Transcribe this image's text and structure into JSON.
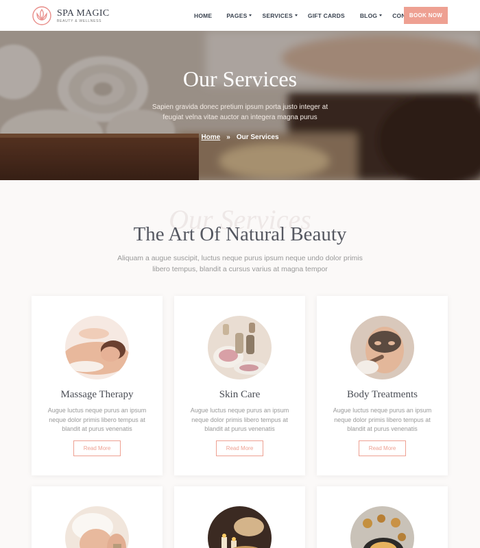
{
  "brand": {
    "name": "SPA MAGIC",
    "tagline": "BEAUTY & WELLNESS",
    "accent": "#eea092"
  },
  "nav": {
    "items": [
      {
        "label": "HOME",
        "dropdown": false
      },
      {
        "label": "PAGES",
        "dropdown": true
      },
      {
        "label": "SERVICES",
        "dropdown": true
      },
      {
        "label": "GIFT CARDS",
        "dropdown": false
      },
      {
        "label": "BLOG",
        "dropdown": true
      },
      {
        "label": "CONTACTS",
        "dropdown": false
      }
    ],
    "cta": "BOOK NOW"
  },
  "hero": {
    "title": "Our Services",
    "subtitle": "Sapien gravida donec pretium ipsum porta justo integer at feugiat velna vitae auctor an integera magna purus",
    "breadcrumb": {
      "home": "Home",
      "separator": "»",
      "current": "Our Services"
    }
  },
  "section": {
    "watermark": "Our Services",
    "title": "The Art Of Natural Beauty",
    "subtitle": "Aliquam a augue suscipit, luctus neque purus ipsum neque undo dolor primis libero tempus, blandit a cursus varius at magna tempor"
  },
  "cards": [
    {
      "title": "Massage Therapy",
      "text": "Augue luctus neque purus an ipsum neque dolor primis libero tempus at blandit at purus venenatis",
      "button": "Read More",
      "image": "massage-photo"
    },
    {
      "title": "Skin Care",
      "text": "Augue luctus neque purus an ipsum neque dolor primis libero tempus at blandit at purus venenatis",
      "button": "Read More",
      "image": "skin-care-photo"
    },
    {
      "title": "Body Treatments",
      "text": "Augue luctus neque purus an ipsum neque dolor primis libero tempus at blandit at purus venenatis",
      "button": "Read More",
      "image": "facial-mask-photo"
    },
    {
      "title": "",
      "text": "",
      "button": "",
      "image": "head-massage-photo"
    },
    {
      "title": "",
      "text": "",
      "button": "",
      "image": "aroma-oil-photo"
    },
    {
      "title": "",
      "text": "",
      "button": "",
      "image": "spa-food-photo"
    }
  ]
}
